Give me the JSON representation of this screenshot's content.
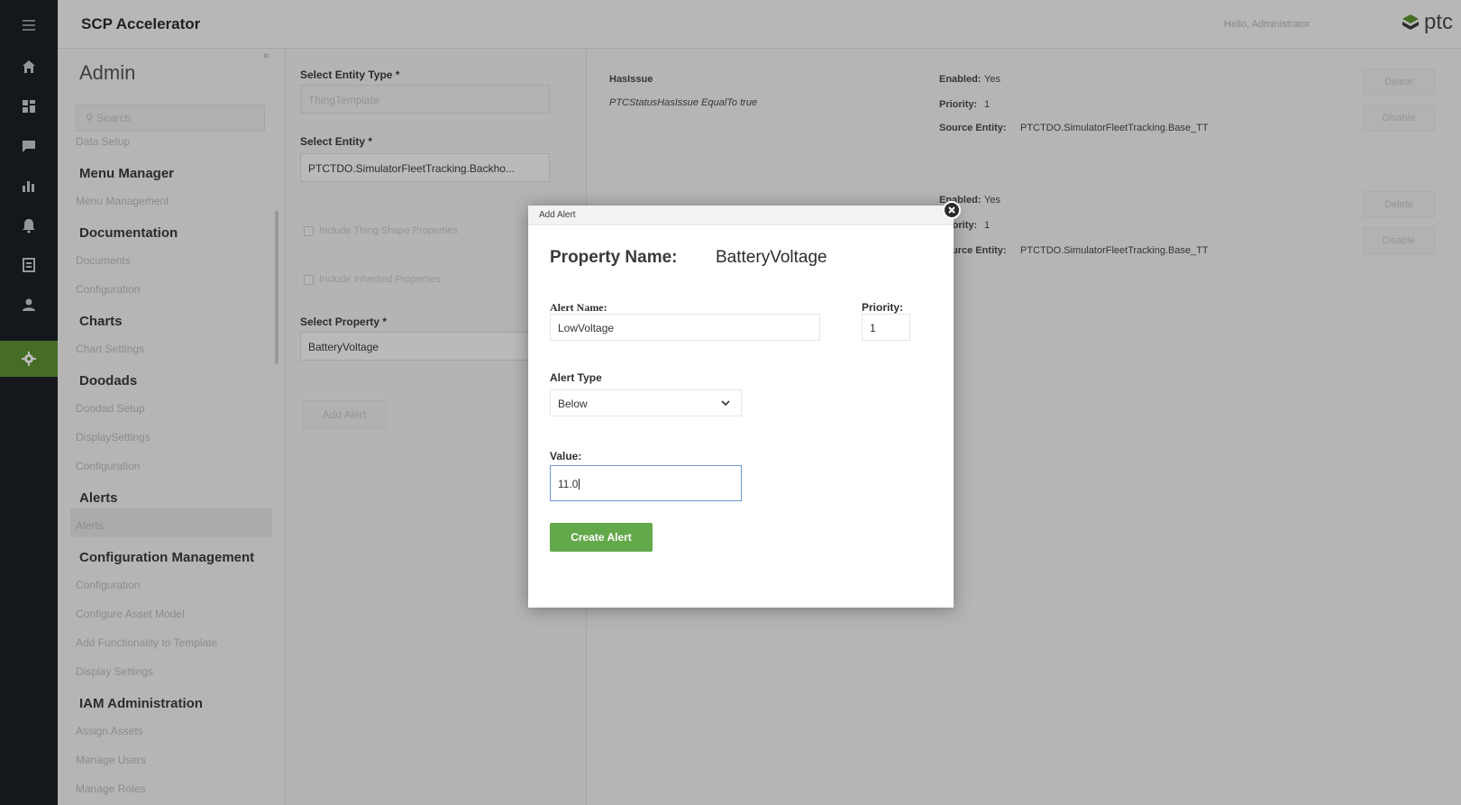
{
  "app": {
    "title": "SCP Accelerator",
    "greeting": "Hello, Administrator",
    "logo_text": "ptc"
  },
  "rail": {
    "items": [
      {
        "icon": "menu-icon"
      },
      {
        "icon": "home-icon"
      },
      {
        "icon": "dashboard-icon"
      },
      {
        "icon": "chat-icon"
      },
      {
        "icon": "chart-icon"
      },
      {
        "icon": "bell-icon"
      },
      {
        "icon": "report-icon"
      },
      {
        "icon": "user-icon"
      },
      {
        "icon": "gear-icon",
        "active": true
      }
    ]
  },
  "sidebar": {
    "title": "Admin",
    "search_placeholder": "Search",
    "partial_item": "Data Setup",
    "sections": [
      {
        "heading": "Menu Manager",
        "items": [
          "Menu Management"
        ]
      },
      {
        "heading": "Documentation",
        "items": [
          "Documents",
          "Configuration"
        ]
      },
      {
        "heading": "Charts",
        "items": [
          "Chart Settings"
        ]
      },
      {
        "heading": "Doodads",
        "items": [
          "Doodad Setup",
          "DisplaySettings",
          "Configuration"
        ]
      },
      {
        "heading": "Alerts",
        "items": [
          "Alerts"
        ]
      },
      {
        "heading": "Configuration Management",
        "items": [
          "Configuration",
          "Configure Asset Model",
          "Add Functionality to Template",
          "Display Settings"
        ]
      },
      {
        "heading": "IAM Administration",
        "items": [
          "Assign Assets",
          "Manage Users",
          "Manage Roles"
        ]
      }
    ]
  },
  "form": {
    "entity_type_label": "Select Entity Type *",
    "entity_type_value": "ThingTemplate",
    "entity_label": "Select Entity *",
    "entity_value": "PTCTDO.SimulatorFleetTracking.Backho...",
    "chk_thing_shape": "Include Thing Shape Properties",
    "chk_inherited": "Include Inherited Properties",
    "property_label": "Select Property *",
    "property_value": "BatteryVoltage",
    "add_alert_button": "Add Alert"
  },
  "alerts_list": {
    "row1": {
      "name": "HasIssue",
      "expression": "PTCStatusHasIssue EqualTo true",
      "enabled_label": "Enabled:",
      "enabled_value": "Yes",
      "priority_label": "Priority:",
      "priority_value": "1",
      "source_label": "Source Entity:",
      "source_value": "PTCTDO.SimulatorFleetTracking.Base_TT",
      "delete_button": "Delete",
      "disable_button": "Disable"
    },
    "row2": {
      "enabled_label": "Enabled:",
      "enabled_value": "Yes",
      "priority_label": "Priority:",
      "priority_value": "1",
      "source_label": "Source Entity:",
      "source_value": "PTCTDO.SimulatorFleetTracking.Base_TT",
      "delete_button": "Delete",
      "disable_button": "Disable"
    }
  },
  "modal": {
    "title": "Add Alert",
    "property_name_label": "Property Name:",
    "property_name_value": "BatteryVoltage",
    "alert_name_label": "Alert Name:",
    "alert_name_value": "LowVoltage",
    "priority_label": "Priority:",
    "priority_value": "1",
    "alert_type_label": "Alert Type",
    "alert_type_value": "Below",
    "value_label": "Value:",
    "value_value": "11.0",
    "create_button": "Create Alert"
  },
  "colors": {
    "rail_bg": "#1c2127",
    "accent_green": "#5f9432",
    "button_green": "#63a84a",
    "focus_blue": "#6a96d0"
  }
}
